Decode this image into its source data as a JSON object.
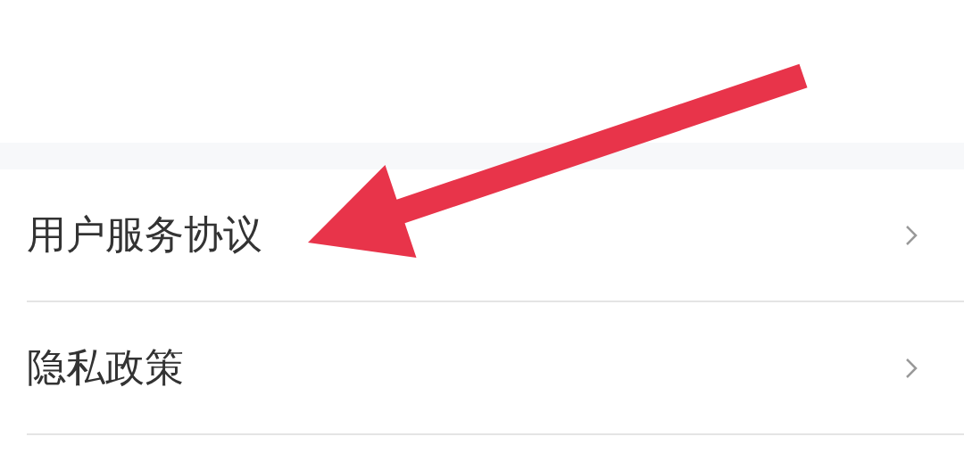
{
  "menu_items": [
    {
      "label": "用户服务协议"
    },
    {
      "label": "隐私政策"
    }
  ]
}
